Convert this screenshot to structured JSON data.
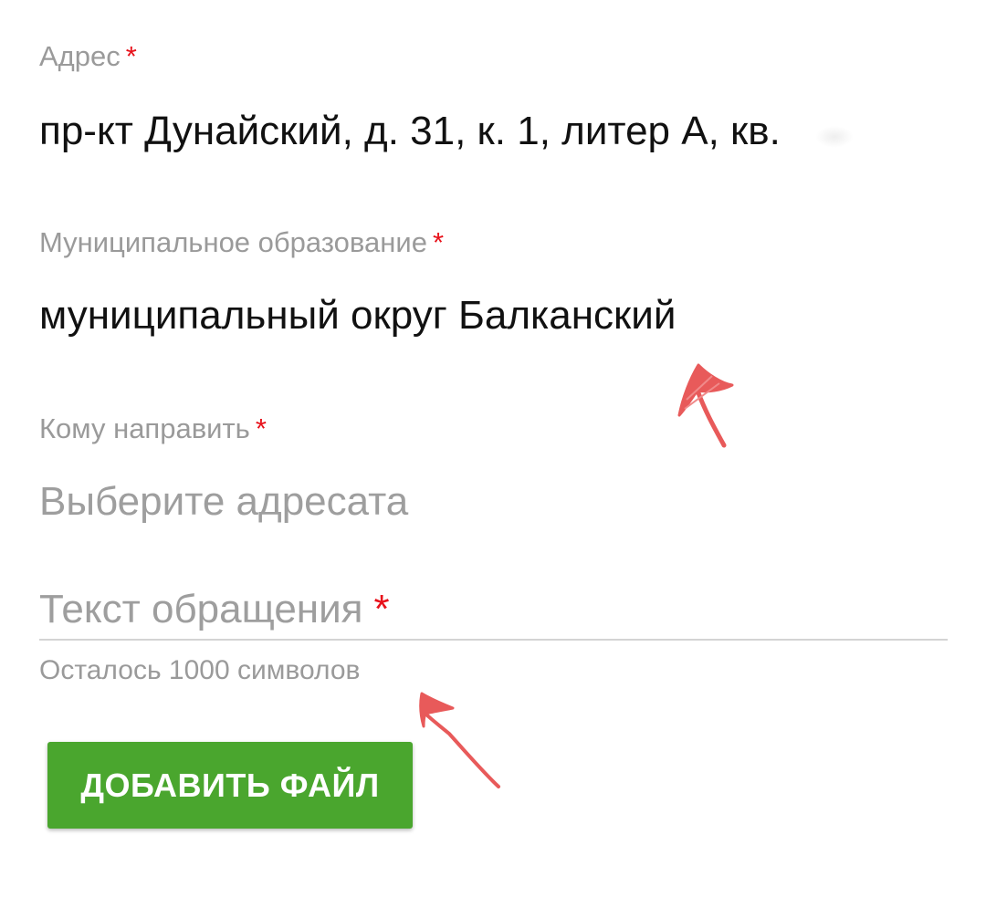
{
  "form": {
    "address": {
      "label": "Адрес",
      "required_mark": "*",
      "value": "пр-кт Дунайский, д. 31, к. 1, литер А, кв."
    },
    "municipality": {
      "label": "Муниципальное образование",
      "required_mark": "*",
      "value": "муниципальный округ Балканский"
    },
    "recipient": {
      "label": "Кому направить",
      "required_mark": "*",
      "placeholder": "Выберите адресата"
    },
    "message": {
      "placeholder": "Текст обращения",
      "required_mark": "*",
      "helper": "Осталось 1000 символов"
    },
    "add_file_button": "ДОБАВИТЬ ФАЙЛ"
  },
  "colors": {
    "label": "#9a9a9a",
    "required": "#e8121b",
    "value": "#111111",
    "button": "#4aa62e",
    "annotation": "#e85a5a"
  },
  "annotations": [
    "arrow-icon",
    "arrow-icon"
  ]
}
